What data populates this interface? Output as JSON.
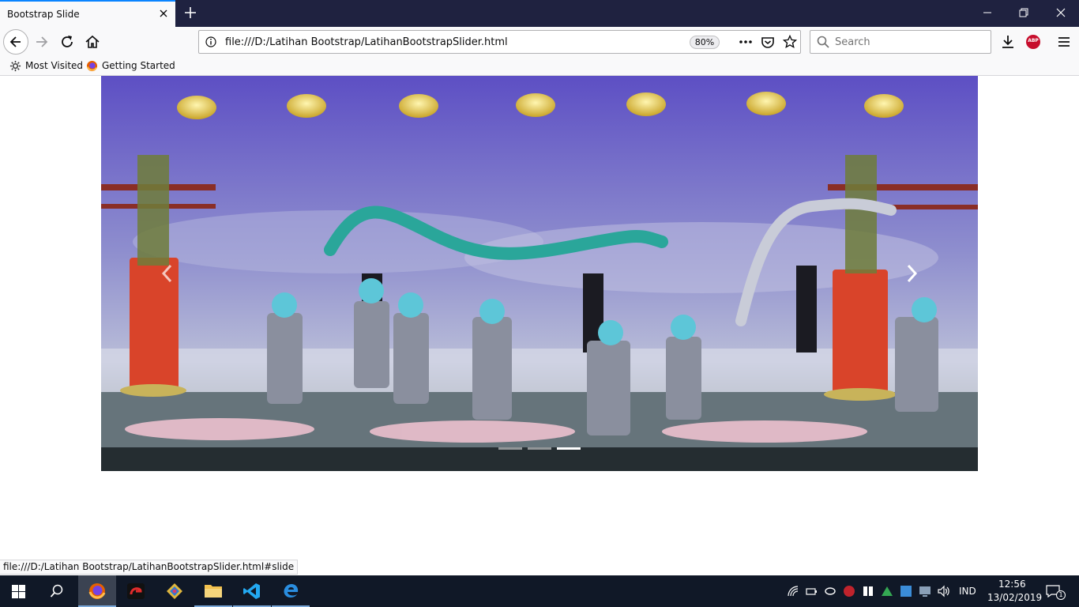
{
  "browser": {
    "tab_title": "Bootstrap Slide",
    "url": "file:///D:/Latihan Bootstrap/LatihanBootstrapSlider.html",
    "zoom": "80%",
    "search_placeholder": "Search",
    "bookmarks": [
      {
        "label": "Most Visited"
      },
      {
        "label": "Getting Started"
      }
    ],
    "status_url": "file:///D:/Latihan Bootstrap/LatihanBootstrapSlider.html#slide",
    "abp_label": "ABP"
  },
  "carousel": {
    "slide_count": 3,
    "active_index": 2
  },
  "taskbar": {
    "language": "IND",
    "time": "12:56",
    "date": "13/02/2019",
    "notification_count": "1"
  },
  "colors": {
    "accent": "#0a84ff",
    "tabbar_bg": "#1f2240",
    "taskbar_bg": "#101827"
  }
}
